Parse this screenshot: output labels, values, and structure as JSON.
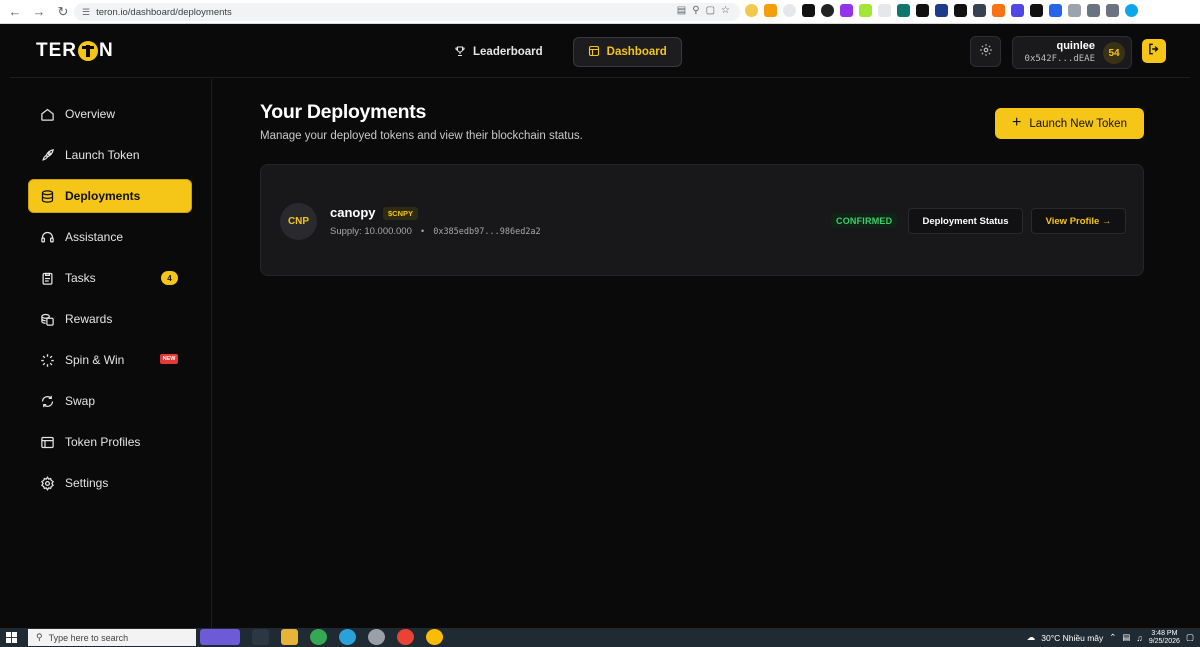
{
  "browser": {
    "url": "teron.io/dashboard/deployments"
  },
  "header": {
    "logo_text_left": "TER",
    "logo_text_right": "N",
    "nav": [
      {
        "label": "Leaderboard",
        "icon": "trophy-icon"
      },
      {
        "label": "Dashboard",
        "icon": "layout-icon"
      }
    ],
    "user": {
      "name": "quinlee",
      "address": "0x542F...dEAE",
      "points": "54"
    }
  },
  "sidebar": {
    "items": [
      {
        "label": "Overview",
        "icon": "home-icon"
      },
      {
        "label": "Launch Token",
        "icon": "rocket-icon"
      },
      {
        "label": "Deployments",
        "icon": "layers-icon"
      },
      {
        "label": "Assistance",
        "icon": "headset-icon"
      },
      {
        "label": "Tasks",
        "icon": "clipboard-icon",
        "badge": "4"
      },
      {
        "label": "Rewards",
        "icon": "coins-icon"
      },
      {
        "label": "Spin & Win",
        "icon": "spinner-icon",
        "badge": "NEW"
      },
      {
        "label": "Swap",
        "icon": "swap-icon"
      },
      {
        "label": "Token Profiles",
        "icon": "profile-card-icon"
      },
      {
        "label": "Settings",
        "icon": "gear-icon"
      }
    ]
  },
  "main": {
    "title": "Your Deployments",
    "subtitle": "Manage your deployed tokens and view their blockchain status.",
    "launch_button": "Launch New Token",
    "deployment": {
      "avatar": "CNP",
      "name": "canopy",
      "symbol": "$CNPY",
      "supply": "Supply: 10.000.000",
      "address": "0x385edb97...986ed2a2",
      "status": "CONFIRMED",
      "status_button": "Deployment Status",
      "profile_button": "View Profile →"
    }
  },
  "taskbar": {
    "search_placeholder": "Type here to search",
    "weather": "30°C  Nhiều mây",
    "time": "3:48 PM",
    "date": "9/25/2026"
  },
  "colors": {
    "accent": "#f5c518",
    "background": "#0a0a0b",
    "card": "#18181b",
    "success": "#3ccf6a"
  }
}
